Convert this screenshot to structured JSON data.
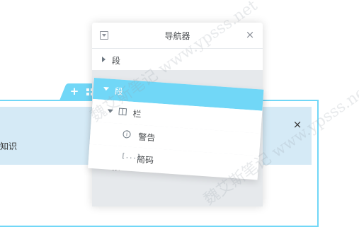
{
  "canvas": {
    "notice_text": "知识",
    "notice_close": "×",
    "handle_add": "+"
  },
  "navigator": {
    "title": "导航器",
    "close": "×",
    "rows": [
      {
        "label": "段"
      },
      {
        "label": "段"
      }
    ],
    "drag_group": {
      "section_label": "段",
      "column_label": "栏",
      "warning_icon": "i",
      "warning_label": "警告",
      "code_icon": "[...]",
      "code_label": "简码"
    }
  },
  "watermarks": {
    "a": "魏艾斯笔记 www.ypsss.net",
    "b": "魏艾斯笔记 www.ypsss.net"
  },
  "colors": {
    "accent": "#71d7f7",
    "notice_bg": "#d5eaf6",
    "panel_bg": "#e6e9ec",
    "text": "#494c4f"
  }
}
